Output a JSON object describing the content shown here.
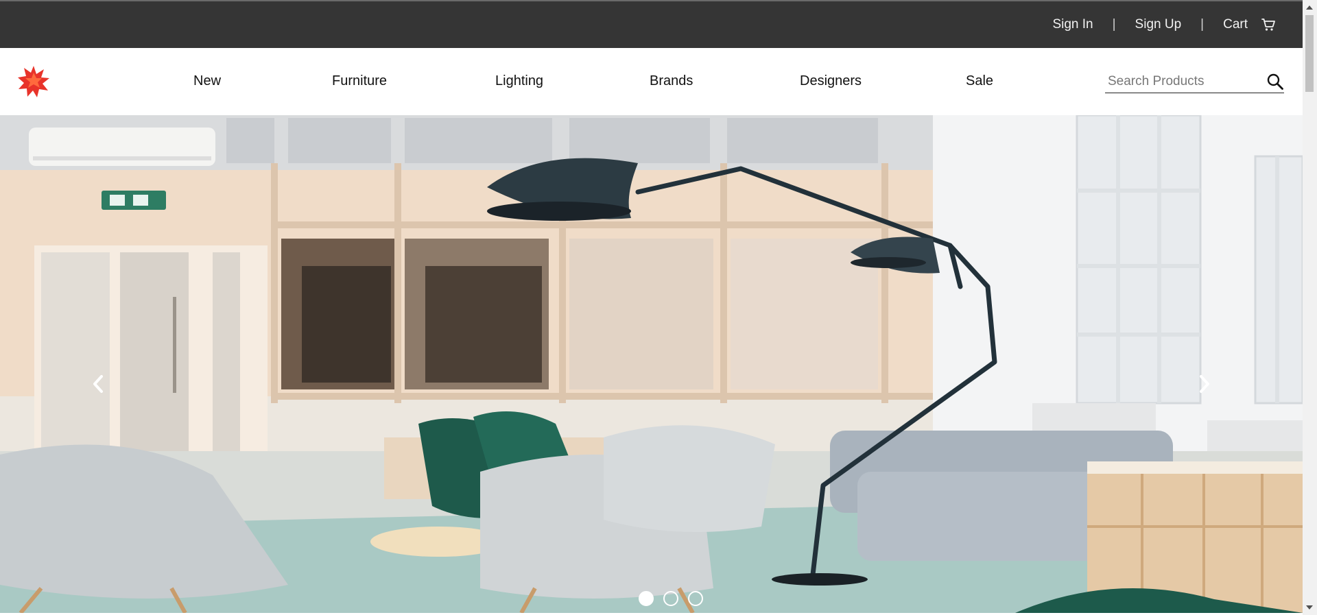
{
  "topbar": {
    "sign_in": "Sign In",
    "separator": "|",
    "sign_up": "Sign Up",
    "cart": "Cart",
    "cart_icon": "cart-icon",
    "background": "#353535"
  },
  "header": {
    "logo_icon": "star-burst-logo",
    "logo_color": "#e8332a",
    "nav": [
      "New",
      "Furniture",
      "Lighting",
      "Brands",
      "Designers",
      "Sale"
    ],
    "search": {
      "placeholder": "Search Products",
      "value": "",
      "icon": "search-icon"
    }
  },
  "hero": {
    "prev_icon": "chevron-left-icon",
    "next_icon": "chevron-right-icon",
    "slides_total": 3,
    "active_slide": 1
  }
}
